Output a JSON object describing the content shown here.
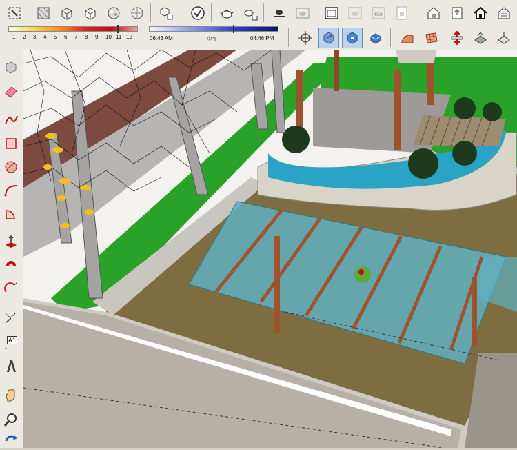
{
  "shadow_settings": {
    "month_labels": [
      "1",
      "2",
      "3",
      "4",
      "5",
      "6",
      "7",
      "8",
      "9",
      "10",
      "11",
      "12"
    ],
    "time_start": "06:43 AM",
    "time_mid": "中午",
    "time_end": "04:46 PM"
  },
  "toolbar_top": {
    "icons": [
      "select-mode-icon",
      "xray-icon",
      "wireframe-cube-icon",
      "hidden-line-cube-icon",
      "shaded-sphere-icon",
      "textured-sphere-icon",
      "cube-hand-icon",
      "check-circle-icon",
      "teapot-icon",
      "teapot-hand-icon",
      "teapot-saucer-icon",
      "teapot-frame-icon",
      "window-frame-icon",
      "teapot-box-icon",
      "cloud-box-icon",
      "page-lock-icon",
      "warehouse-icon",
      "upload-model-icon",
      "home-icon",
      "component-home-icon"
    ]
  },
  "toolbar_second": {
    "icons": [
      "move-axis-icon",
      "section-plane-icon",
      "section-display-icon",
      "section-cut-icon",
      "sandbox-icon",
      "grid-icon",
      "stamp-icon",
      "drape-icon"
    ]
  },
  "left_tools": {
    "icons": [
      "eraser-box-icon",
      "eraser-icon",
      "freehand-icon",
      "rectangle-icon",
      "rotated-rectangle-icon",
      "arc-icon",
      "pie-icon",
      "push-pull-icon",
      "follow-me-icon",
      "tape-measure-icon",
      "axes-icon",
      "text-icon",
      "3d-text-icon",
      "pan-icon",
      "zoom-icon",
      "orbit-icon"
    ],
    "text_tool_label": "A1"
  },
  "colors": {
    "toolbar_bg": "#ece9e2",
    "active_tool": "#bcd3ee",
    "grass": "#2aa22a",
    "ground": "#7d6d40",
    "water": "#2aa3c4",
    "glass": "#5fb0c0",
    "wood": "#a0522d"
  }
}
